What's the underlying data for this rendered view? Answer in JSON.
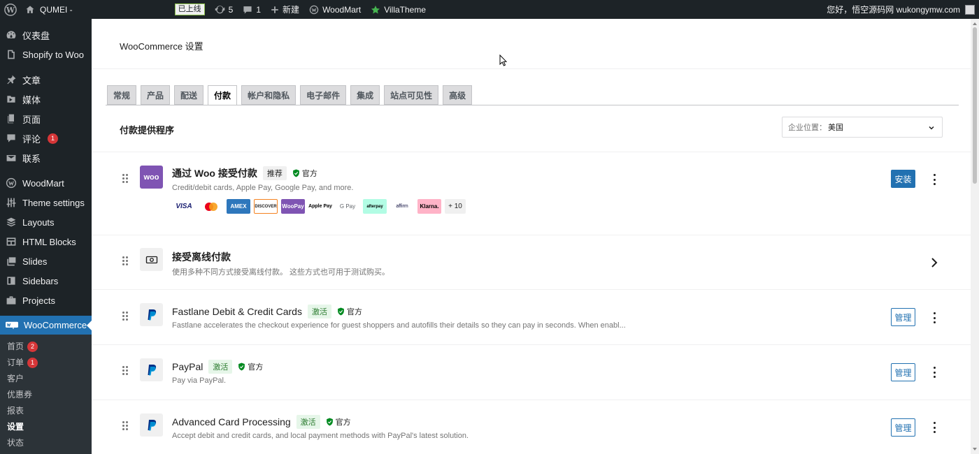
{
  "admin_bar": {
    "site_name": "QUMEI -",
    "status_badge": "已上线",
    "updates_count": "5",
    "comments_count": "1",
    "new_label": "新建",
    "woodmart_label": "WoodMart",
    "villatheme_label": "VillaTheme",
    "greeting": "您好，悟空源码网 wukongymw.com"
  },
  "sidebar": {
    "items": [
      {
        "label": "仪表盘",
        "icon": "dashboard-icon"
      },
      {
        "label": "Shopify to Woo",
        "icon": "shopify-icon"
      },
      {
        "label": "文章",
        "icon": "pin-icon"
      },
      {
        "label": "媒体",
        "icon": "media-icon"
      },
      {
        "label": "页面",
        "icon": "page-icon"
      },
      {
        "label": "评论",
        "icon": "comment-icon",
        "count": "1"
      },
      {
        "label": "联系",
        "icon": "mail-icon"
      },
      {
        "label": "WoodMart",
        "icon": "woodmart-icon"
      },
      {
        "label": "Theme settings",
        "icon": "sliders-icon"
      },
      {
        "label": "Layouts",
        "icon": "layers-icon"
      },
      {
        "label": "HTML Blocks",
        "icon": "blocks-icon"
      },
      {
        "label": "Slides",
        "icon": "slides-icon"
      },
      {
        "label": "Sidebars",
        "icon": "sidebar-icon"
      },
      {
        "label": "Projects",
        "icon": "briefcase-icon"
      },
      {
        "label": "WooCommerce",
        "icon": "woo-icon"
      }
    ],
    "submenu": [
      {
        "label": "首页",
        "count": "2"
      },
      {
        "label": "订单",
        "count": "1"
      },
      {
        "label": "客户"
      },
      {
        "label": "优惠券"
      },
      {
        "label": "报表"
      },
      {
        "label": "设置"
      },
      {
        "label": "状态"
      }
    ]
  },
  "main": {
    "page_title": "WooCommerce 设置",
    "tabs": [
      "常规",
      "产品",
      "配送",
      "付款",
      "帐户和隐私",
      "电子邮件",
      "集成",
      "站点可见性",
      "高级"
    ],
    "active_tab": "付款",
    "section_title": "付款提供程序",
    "location": {
      "label": "企业位置：",
      "value": "美国"
    }
  },
  "gateways": [
    {
      "name": "通过 Woo 接受付款",
      "icon_text": "woo",
      "badge": "推荐",
      "official": "官方",
      "description": "Credit/debit cards, Apple Pay, Google Pay, and more.",
      "action": "安装",
      "cards": [
        "VISA",
        "MC",
        "AMEX",
        "DISCOVER",
        "WooPay",
        "Apple Pay",
        "G Pay",
        "afterpay",
        "affirm",
        "Klarna."
      ],
      "more": "+ 10"
    },
    {
      "name": "接受离线付款",
      "description": "使用多种不同方式接受离线付款。 这些方式也可用于测试购买。"
    },
    {
      "name": "Fastlane Debit & Credit Cards",
      "badge": "激活",
      "official": "官方",
      "description": "Fastlane accelerates the checkout experience for guest shoppers and autofills their details so they can pay in seconds. When enabl...",
      "action": "管理"
    },
    {
      "name": "PayPal",
      "badge": "激活",
      "official": "官方",
      "description": "Pay via PayPal.",
      "action": "管理"
    },
    {
      "name": "Advanced Card Processing",
      "badge": "激活",
      "official": "官方",
      "description": "Accept debit and credit cards, and local payment methods with PayPal's latest solution.",
      "action": "管理"
    }
  ],
  "colors": {
    "admin_dark": "#1d2327",
    "accent_blue": "#2271b1",
    "woo_purple": "#7f54b3",
    "active_green": "#2e7d32",
    "count_red": "#d63638"
  }
}
